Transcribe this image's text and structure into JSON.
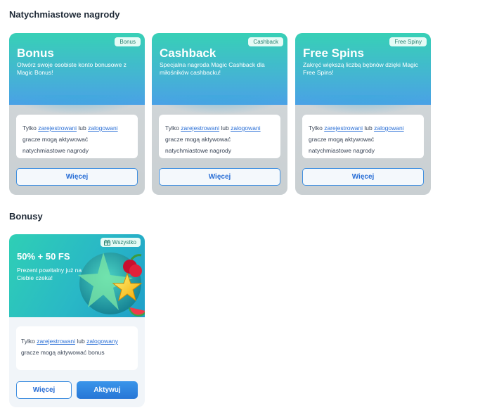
{
  "instant": {
    "heading": "Natychmiastowe nagrody",
    "cards": [
      {
        "badge": "Bonus",
        "title": "Bonus",
        "description": "Otwórz swoje osobiste konto bonusowe z Magic Bonus!",
        "info_prefix": "Tylko ",
        "info_link1": "zarejestrowani",
        "info_mid": " lub ",
        "info_link2": "zalogowani",
        "info_suffix": " gracze mogą aktywować natychmiastowe nagrody",
        "button": "Więcej"
      },
      {
        "badge": "Cashback",
        "title": "Cashback",
        "description": "Specjalna nagroda Magic Cashback dla miłośników cashbacku!",
        "info_prefix": "Tylko ",
        "info_link1": "zarejestrowani",
        "info_mid": " lub ",
        "info_link2": "zalogowani",
        "info_suffix": " gracze mogą aktywować natychmiastowe nagrody",
        "button": "Więcej"
      },
      {
        "badge": "Free Spiny",
        "title": "Free Spins",
        "description": "Zakręć większą liczbą bębnów dzięki Magic Free Spins!",
        "info_prefix": "Tylko ",
        "info_link1": "zarejestrowani",
        "info_mid": " lub ",
        "info_link2": "zalogowani",
        "info_suffix": " gracze mogą aktywować natychmiastowe nagrody",
        "button": "Więcej"
      }
    ]
  },
  "bonuses": {
    "heading": "Bonusy",
    "card": {
      "badge": "Wszystko",
      "title": "50% + 50 FS",
      "description": "Prezent powitalny już na Ciebie czeka!",
      "info_prefix": "Tylko ",
      "info_link1": "zarejestrowani",
      "info_mid": " lub ",
      "info_link2": "zalogowany",
      "info_suffix": " gracze mogą aktywować bonus",
      "more_button": "Więcej",
      "activate_button": "Aktywuj"
    }
  },
  "colors": {
    "accent": "#2a6fd6",
    "header_gradient_start": "#37d0b6",
    "header_gradient_end": "#4aa1e6"
  }
}
